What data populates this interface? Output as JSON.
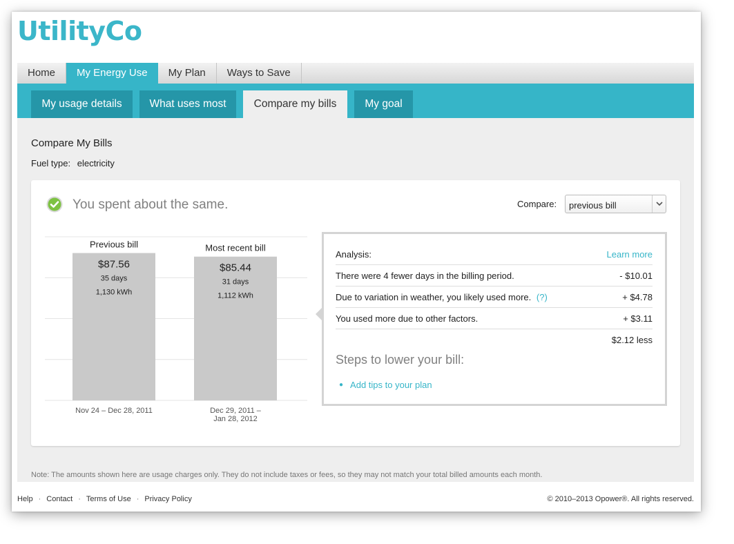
{
  "brand": {
    "logo": "UtilityCo",
    "accent": "#36b5c8",
    "accent_dark": "#2596a8"
  },
  "main_tabs": [
    {
      "label": "Home",
      "active": false
    },
    {
      "label": "My Energy Use",
      "active": true
    },
    {
      "label": "My Plan",
      "active": false
    },
    {
      "label": "Ways to Save",
      "active": false
    }
  ],
  "sub_tabs": [
    {
      "label": "My usage details",
      "active": false
    },
    {
      "label": "What uses most",
      "active": false
    },
    {
      "label": "Compare my bills",
      "active": true
    },
    {
      "label": "My goal",
      "active": false
    }
  ],
  "page": {
    "title": "Compare My Bills",
    "fuel_label": "Fuel type:",
    "fuel_value": "electricity"
  },
  "summary": {
    "icon": "check-circle-icon",
    "headline": "You spent about the same.",
    "compare_label": "Compare:",
    "compare_value": "previous bill"
  },
  "bills": [
    {
      "label": "Previous bill",
      "amount": "$87.56",
      "days": "35 days",
      "kwh": "1,130 kWh",
      "period": [
        "Nov 24 – Dec 28, 2011"
      ],
      "value": 87.56
    },
    {
      "label": "Most recent bill",
      "amount": "$85.44",
      "days": "31 days",
      "kwh": "1,112 kWh",
      "period": [
        "Dec 29, 2011 –",
        "Jan 28, 2012"
      ],
      "value": 85.44
    }
  ],
  "analysis": {
    "title": "Analysis:",
    "learn_more": "Learn more",
    "rows": [
      {
        "text": "There were 4 fewer days in the billing period.",
        "amount": "- $10.01"
      },
      {
        "text": "Due to variation in weather, you likely used more.",
        "help": "(?)",
        "amount": "+ $4.78"
      },
      {
        "text": "You used more due to other factors.",
        "amount": "+ $3.11"
      }
    ],
    "total": "$2.12 less",
    "steps_title": "Steps to lower your bill:",
    "tips": [
      "Add tips to your plan"
    ]
  },
  "note": "Note: The amounts shown here are usage charges only. They do not include taxes or fees, so they may not match your total billed amounts each month.",
  "footer": {
    "links": [
      "Help",
      "Contact",
      "Terms of Use",
      "Privacy Policy"
    ],
    "copyright": "© 2010–2013 Opower®. All rights reserved."
  }
}
